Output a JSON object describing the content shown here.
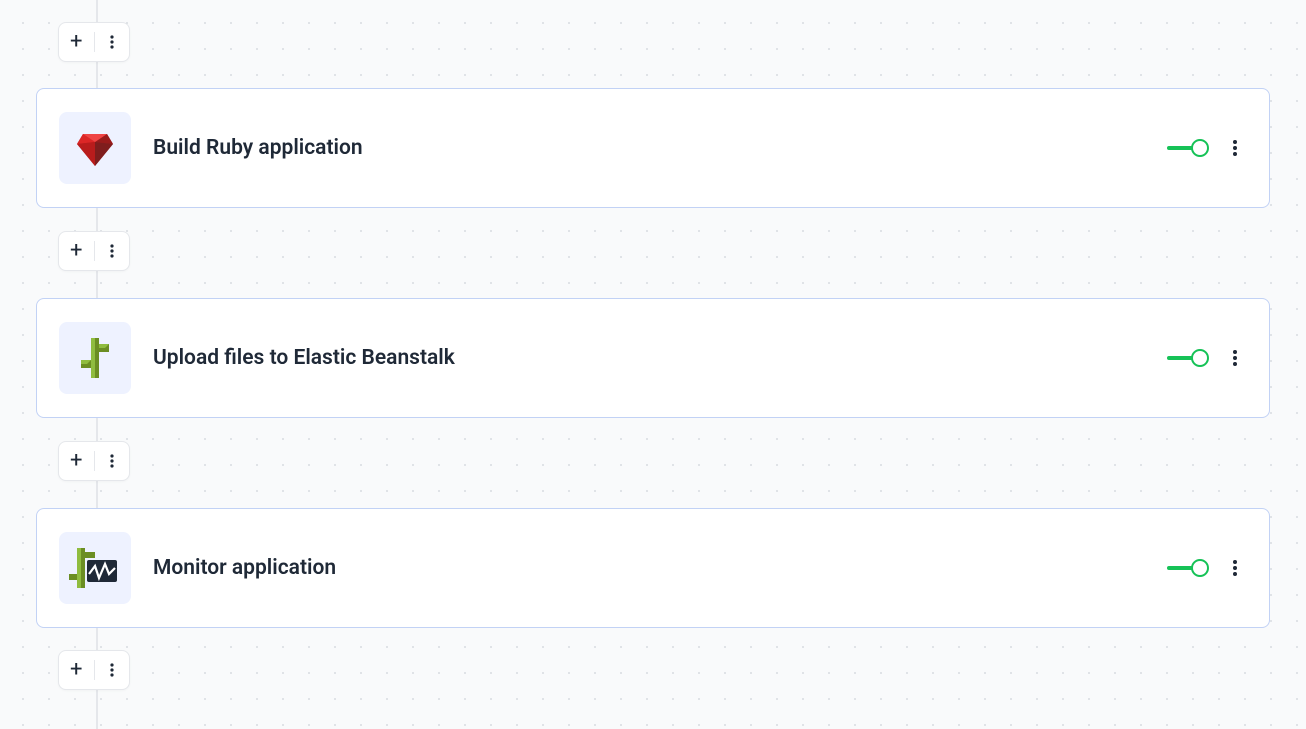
{
  "steps": [
    {
      "title": "Build Ruby application",
      "icon": "ruby",
      "enabled": true
    },
    {
      "title": "Upload files to Elastic Beanstalk",
      "icon": "beanstalk",
      "enabled": true
    },
    {
      "title": "Monitor application",
      "icon": "monitor",
      "enabled": true
    }
  ],
  "colors": {
    "toggle_on": "#16c257",
    "card_border": "#c2d2f5",
    "icon_bg": "#eef2ff"
  }
}
